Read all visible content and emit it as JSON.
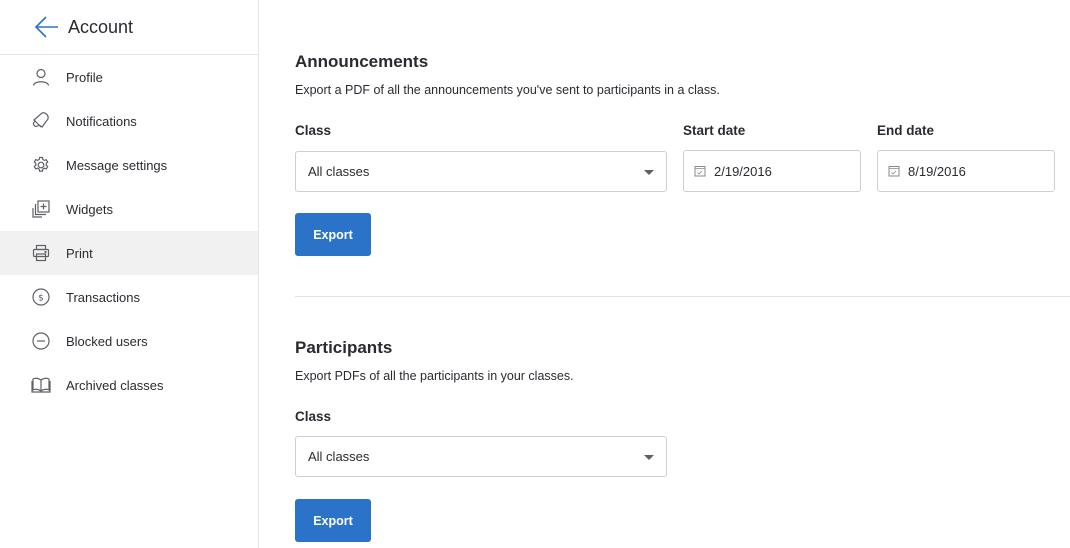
{
  "sidebar": {
    "title": "Account",
    "back_icon": "arrow-left-icon",
    "items": [
      {
        "label": "Profile",
        "icon": "user-icon",
        "active": false
      },
      {
        "label": "Notifications",
        "icon": "bell-icon",
        "active": false
      },
      {
        "label": "Message settings",
        "icon": "gear-icon",
        "active": false
      },
      {
        "label": "Widgets",
        "icon": "widget-add-icon",
        "active": false
      },
      {
        "label": "Print",
        "icon": "printer-icon",
        "active": true
      },
      {
        "label": "Transactions",
        "icon": "dollar-circle-icon",
        "active": false
      },
      {
        "label": "Blocked users",
        "icon": "minus-circle-icon",
        "active": false
      },
      {
        "label": "Archived classes",
        "icon": "book-icon",
        "active": false
      }
    ]
  },
  "announcements": {
    "title": "Announcements",
    "description": "Export a PDF of all the announcements you've sent to participants in a class.",
    "class_label": "Class",
    "class_value": "All classes",
    "start_label": "Start date",
    "start_value": "2/19/2016",
    "end_label": "End date",
    "end_value": "8/19/2016",
    "export_label": "Export"
  },
  "participants": {
    "title": "Participants",
    "description": "Export PDFs of all the participants in your classes.",
    "class_label": "Class",
    "class_value": "All classes",
    "export_label": "Export"
  },
  "colors": {
    "accent": "#2a73c8",
    "active_bg": "#f1f1f1"
  }
}
